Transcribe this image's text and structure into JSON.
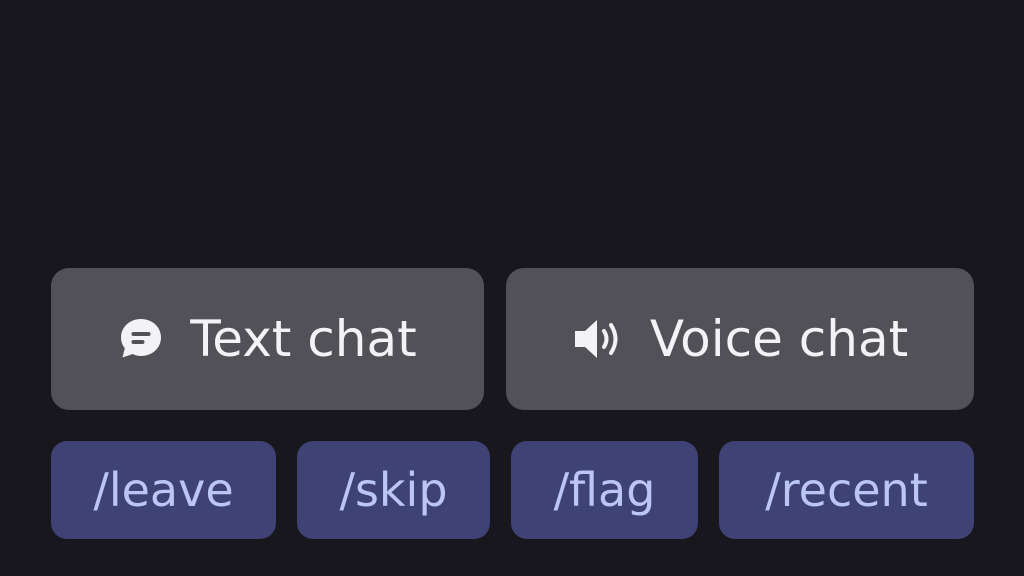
{
  "modes": {
    "text": {
      "label": "Text chat",
      "icon": "chat-bubble-icon"
    },
    "voice": {
      "label": "Voice chat",
      "icon": "speaker-icon"
    }
  },
  "commands": [
    {
      "label": "/leave"
    },
    {
      "label": "/skip"
    },
    {
      "label": "/flag"
    },
    {
      "label": "/recent"
    }
  ],
  "colors": {
    "background": "#18171d",
    "mode_button": "#515157",
    "mode_text": "#f3f3f5",
    "command_button": "#3e4274",
    "command_text": "#bcc6f4"
  }
}
